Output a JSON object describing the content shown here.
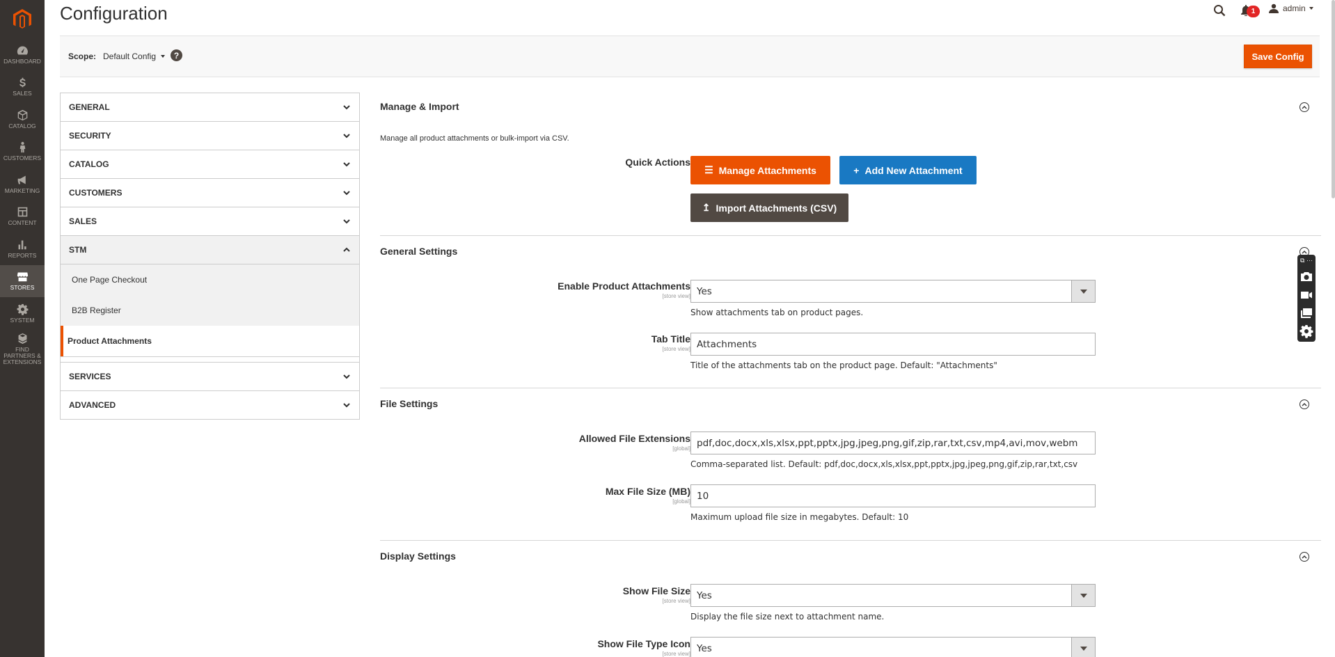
{
  "admin_menu": {
    "items": [
      {
        "label": "DASHBOARD",
        "icon": "speedometer-icon"
      },
      {
        "label": "SALES",
        "icon": "dollar-icon"
      },
      {
        "label": "CATALOG",
        "icon": "box-icon"
      },
      {
        "label": "CUSTOMERS",
        "icon": "person-icon"
      },
      {
        "label": "MARKETING",
        "icon": "megaphone-icon"
      },
      {
        "label": "CONTENT",
        "icon": "layout-icon"
      },
      {
        "label": "REPORTS",
        "icon": "bar-chart-icon"
      },
      {
        "label": "STORES",
        "icon": "storefront-icon"
      },
      {
        "label": "SYSTEM",
        "icon": "gear-icon"
      },
      {
        "label": "FIND PARTNERS & EXTENSIONS",
        "icon": "cubes-icon"
      }
    ],
    "active": "STORES"
  },
  "header": {
    "title": "Configuration",
    "notifications_count": "1",
    "user": "admin"
  },
  "scope": {
    "label": "Scope:",
    "value": "Default Config",
    "help": "?",
    "save_label": "Save Config"
  },
  "nav": {
    "general": "GENERAL",
    "security": "SECURITY",
    "catalog": "CATALOG",
    "customers": "CUSTOMERS",
    "sales": "SALES",
    "stm": "STM",
    "stm_items": [
      "One Page Checkout",
      "B2B Register",
      "Product Attachments"
    ],
    "services": "SERVICES",
    "advanced": "ADVANCED"
  },
  "manage": {
    "title": "Manage & Import",
    "desc": "Manage all product attachments or bulk-import via CSV.",
    "quick_actions_label": "Quick Actions",
    "btn_manage": "Manage Attachments",
    "btn_add": "Add New Attachment",
    "btn_import": "Import Attachments (CSV)",
    "color_orange": "#eb5202",
    "color_blue": "#1979c3",
    "color_dark": "#514943"
  },
  "general": {
    "title": "General Settings",
    "enable_label": "Enable Product Attachments",
    "enable_scope": "[store view]",
    "enable_value": "Yes",
    "enable_note": "Show attachments tab on product pages.",
    "tab_label": "Tab Title",
    "tab_scope": "[store view]",
    "tab_value": "Attachments",
    "tab_note": "Title of the attachments tab on the product page. Default: \"Attachments\""
  },
  "file": {
    "title": "File Settings",
    "ext_label": "Allowed File Extensions",
    "ext_scope": "[global]",
    "ext_value": "pdf,doc,docx,xls,xlsx,ppt,pptx,jpg,jpeg,png,gif,zip,rar,txt,csv,mp4,avi,mov,webm",
    "ext_note": "Comma-separated list. Default: pdf,doc,docx,xls,xlsx,ppt,pptx,jpg,jpeg,png,gif,zip,rar,txt,csv",
    "size_label": "Max File Size (MB)",
    "size_scope": "[global]",
    "size_value": "10",
    "size_note": "Maximum upload file size in megabytes. Default: 10"
  },
  "display": {
    "title": "Display Settings",
    "showsize_label": "Show File Size",
    "showsize_scope": "[store view]",
    "showsize_value": "Yes",
    "showsize_note": "Display the file size next to attachment name.",
    "showicon_label": "Show File Type Icon",
    "showicon_scope": "[store view]",
    "showicon_value": "Yes"
  }
}
